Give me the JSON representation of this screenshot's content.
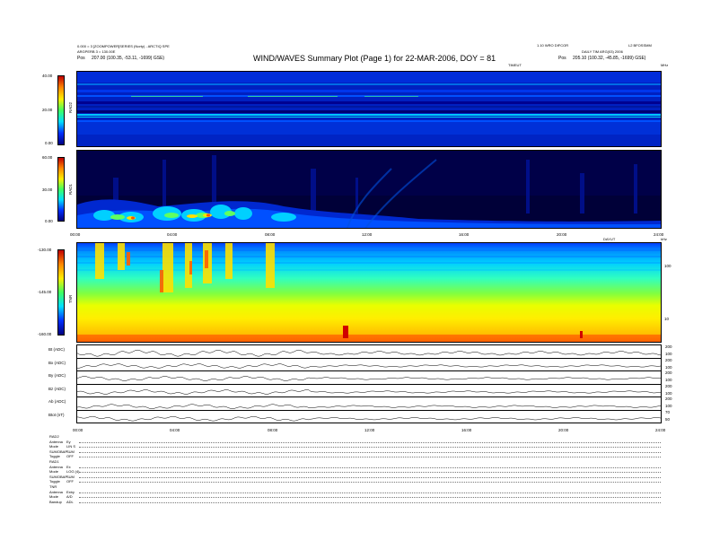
{
  "header": {
    "title": "WIND/WAVES Summary Plot (Page 1) for 22-MAR-2006, DOY = 81",
    "left_line1": "0.000 = 3 [ZOOMPOWER]SERIES (Norty) - ARCTIQ SPE",
    "left_line2": "ARGPERB 3 = 130.00E",
    "left_pos_label": "Pos",
    "left_pos_value": "207.00 (100.35, -53.11, -1699) GSE)",
    "right_line1": "1.10 WRO DIFCOR",
    "right_line1b": "L2 BFOSSMM",
    "right_line2": "DAILY TIM ARG(03) 2006",
    "right_pos_label": "Pos",
    "right_pos_value": "205.10 (100.32, -45.85, -1699) GSE)",
    "time_label": "TIMEUT",
    "mhz_label": "MHz",
    "khz_label": "kHz",
    "ut_label": "DAYUT"
  },
  "chart_data": [
    {
      "type": "heatmap",
      "name": "RAD2",
      "ylabel": "RAD2",
      "colorbar_ticks": [
        "40.00",
        "20.00",
        "0.00"
      ],
      "colorbar_range": [
        0,
        40
      ]
    },
    {
      "type": "heatmap",
      "name": "RAD1",
      "ylabel": "RAD1",
      "colorbar_ticks": [
        "60.00",
        "30.00",
        "0.00"
      ],
      "colorbar_range": [
        0,
        60
      ],
      "x_ticks": [
        "00:00",
        "04:00",
        "08:00",
        "12:00",
        "16:00",
        "20:00",
        "24:00"
      ]
    },
    {
      "type": "heatmap",
      "name": "TNR",
      "ylabel": "TNR",
      "colorbar_ticks": [
        "-130.00",
        "-145.00",
        "-160.00"
      ],
      "colorbar_range": [
        -160,
        -130
      ],
      "right_ticks": [
        "100",
        "10"
      ]
    },
    {
      "type": "line",
      "strips": [
        {
          "label": "Bt (ADC)",
          "right": [
            "200",
            "100"
          ]
        },
        {
          "label": "Bx (ADC)",
          "right": [
            "200",
            "100"
          ]
        },
        {
          "label": "By (ADC)",
          "right": [
            "200",
            "100"
          ]
        },
        {
          "label": "Bz (ADC)",
          "right": [
            "200",
            "100"
          ]
        },
        {
          "label": "Ab (ADC)",
          "right": [
            "200",
            "100"
          ]
        },
        {
          "label": "Btot (nT)",
          "right": [
            "70",
            "50"
          ]
        }
      ],
      "x_ticks": [
        "00:00",
        "04:00",
        "08:00",
        "12:00",
        "16:00",
        "20:00",
        "24:00"
      ]
    }
  ],
  "footer": {
    "blocks": [
      {
        "heading": "RAD2",
        "rows": [
          {
            "k": "Antenna",
            "v": "Ey"
          },
          {
            "k": "Mode",
            "v": "LIN S"
          },
          {
            "k": "SUMOBAP",
            "v": "SUM"
          },
          {
            "k": "Toggle",
            "v": "OFF"
          }
        ]
      },
      {
        "heading": "RAD1",
        "rows": [
          {
            "k": "Antenna",
            "v": "Ex"
          },
          {
            "k": "Mode",
            "v": "LOG (4)"
          },
          {
            "k": "SUMOBAP",
            "v": "SUM"
          },
          {
            "k": "Toggle",
            "v": "OFF"
          }
        ]
      },
      {
        "heading": "TNR",
        "rows": [
          {
            "k": "Antenna",
            "v": "Exby"
          },
          {
            "k": "Mode",
            "v": "A/D"
          },
          {
            "k": "Bandup",
            "v": "ADL"
          }
        ]
      }
    ]
  },
  "colors": {
    "deep_blue": "#00008c",
    "blue": "#0010d0",
    "cyan": "#00e0ff",
    "green": "#40ff60",
    "yellow": "#ffee00",
    "orange": "#ff9900",
    "red": "#e00000"
  }
}
